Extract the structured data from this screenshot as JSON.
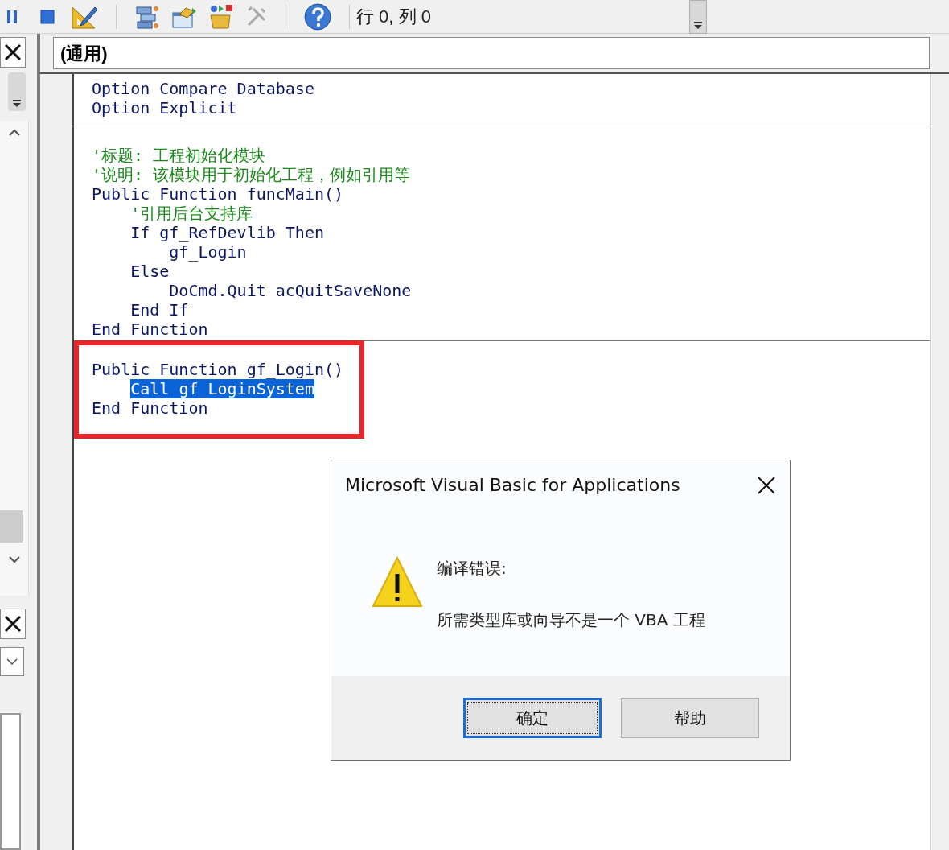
{
  "toolbar": {
    "position": "行 0, 列 0"
  },
  "object_combo": {
    "value": "(通用)"
  },
  "procedures": [
    {
      "highlighted": false,
      "lines": [
        {
          "kind": "code",
          "text": "Option Compare Database",
          "selected": false
        },
        {
          "kind": "code",
          "text": "Option Explicit",
          "selected": false
        }
      ]
    },
    {
      "highlighted": false,
      "lines": [
        {
          "kind": "comment",
          "text": "'标题: 工程初始化模块",
          "selected": false
        },
        {
          "kind": "comment",
          "text": "'说明: 该模块用于初始化工程，例如引用等",
          "selected": false
        },
        {
          "kind": "code",
          "text": "Public Function funcMain()",
          "selected": false
        },
        {
          "kind": "comment",
          "text": "    '引用后台支持库",
          "selected": false
        },
        {
          "kind": "code",
          "text": "    If gf_RefDevlib Then",
          "selected": false
        },
        {
          "kind": "code",
          "text": "        gf_Login",
          "selected": false
        },
        {
          "kind": "code",
          "text": "    Else",
          "selected": false
        },
        {
          "kind": "code",
          "text": "        DoCmd.Quit acQuitSaveNone",
          "selected": false
        },
        {
          "kind": "code",
          "text": "    End If",
          "selected": false
        },
        {
          "kind": "code",
          "text": "End Function",
          "selected": false
        }
      ]
    },
    {
      "highlighted": true,
      "lines": [
        {
          "kind": "code",
          "text": "Public Function gf_Login()",
          "selected": false
        },
        {
          "kind": "code",
          "text": "    Call gf_LoginSystem",
          "selected": true
        },
        {
          "kind": "code",
          "text": "End Function",
          "selected": false
        }
      ]
    }
  ],
  "dialog": {
    "title": "Microsoft Visual Basic for Applications",
    "heading": "编译错误:",
    "message": "所需类型库或向导不是一个 VBA 工程",
    "buttons": [
      {
        "label": "确定",
        "default": true
      },
      {
        "label": "帮助",
        "default": false
      }
    ]
  }
}
